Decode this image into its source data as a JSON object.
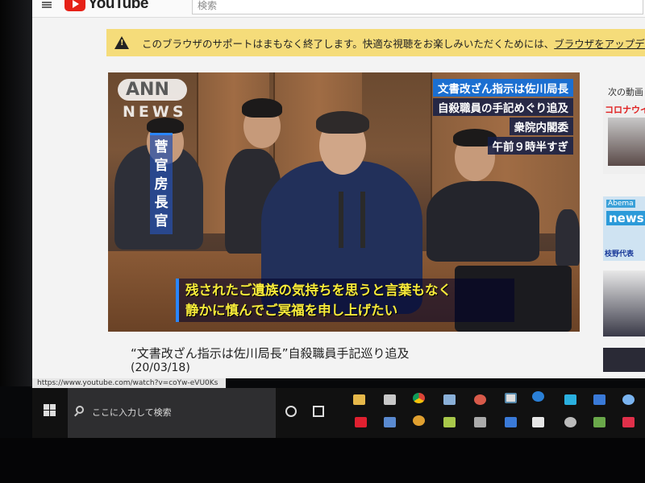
{
  "header": {
    "logo_text": "YouTube",
    "search_placeholder": "検索"
  },
  "banner": {
    "message": "このブラウザのサポートはまもなく終了します。快適な視聴をお楽しみいただくためには、",
    "link_text": "ブラウザをアップデー"
  },
  "video": {
    "ann_logo": "ANN",
    "news_logo": "NEWS",
    "caption_top": [
      "文書改ざん指示は佐川局長",
      "自殺職員の手記めぐり追及",
      "衆院内閣委",
      "午前９時半すぎ"
    ],
    "speaker_name": "菅官房長官",
    "subtitles": [
      "残されたご遺族の気持ちを思うと言葉もなく",
      "静かに慎んでご冥福を申し上げたい"
    ],
    "title": "“文書改ざん指示は佐川局長”自殺職員手記巡り追及",
    "date": "(20/03/18)"
  },
  "sidebar": {
    "next_label": "次の動画",
    "thumb1_text": "コロナウイル",
    "thumb2_brand": "Abema",
    "thumb2_news": "news",
    "thumb2_sub": "枝野代表"
  },
  "status_url": "https://www.youtube.com/watch?v=coYw-eVU0Ks",
  "taskbar": {
    "search_text": "ここに入力して検索"
  }
}
